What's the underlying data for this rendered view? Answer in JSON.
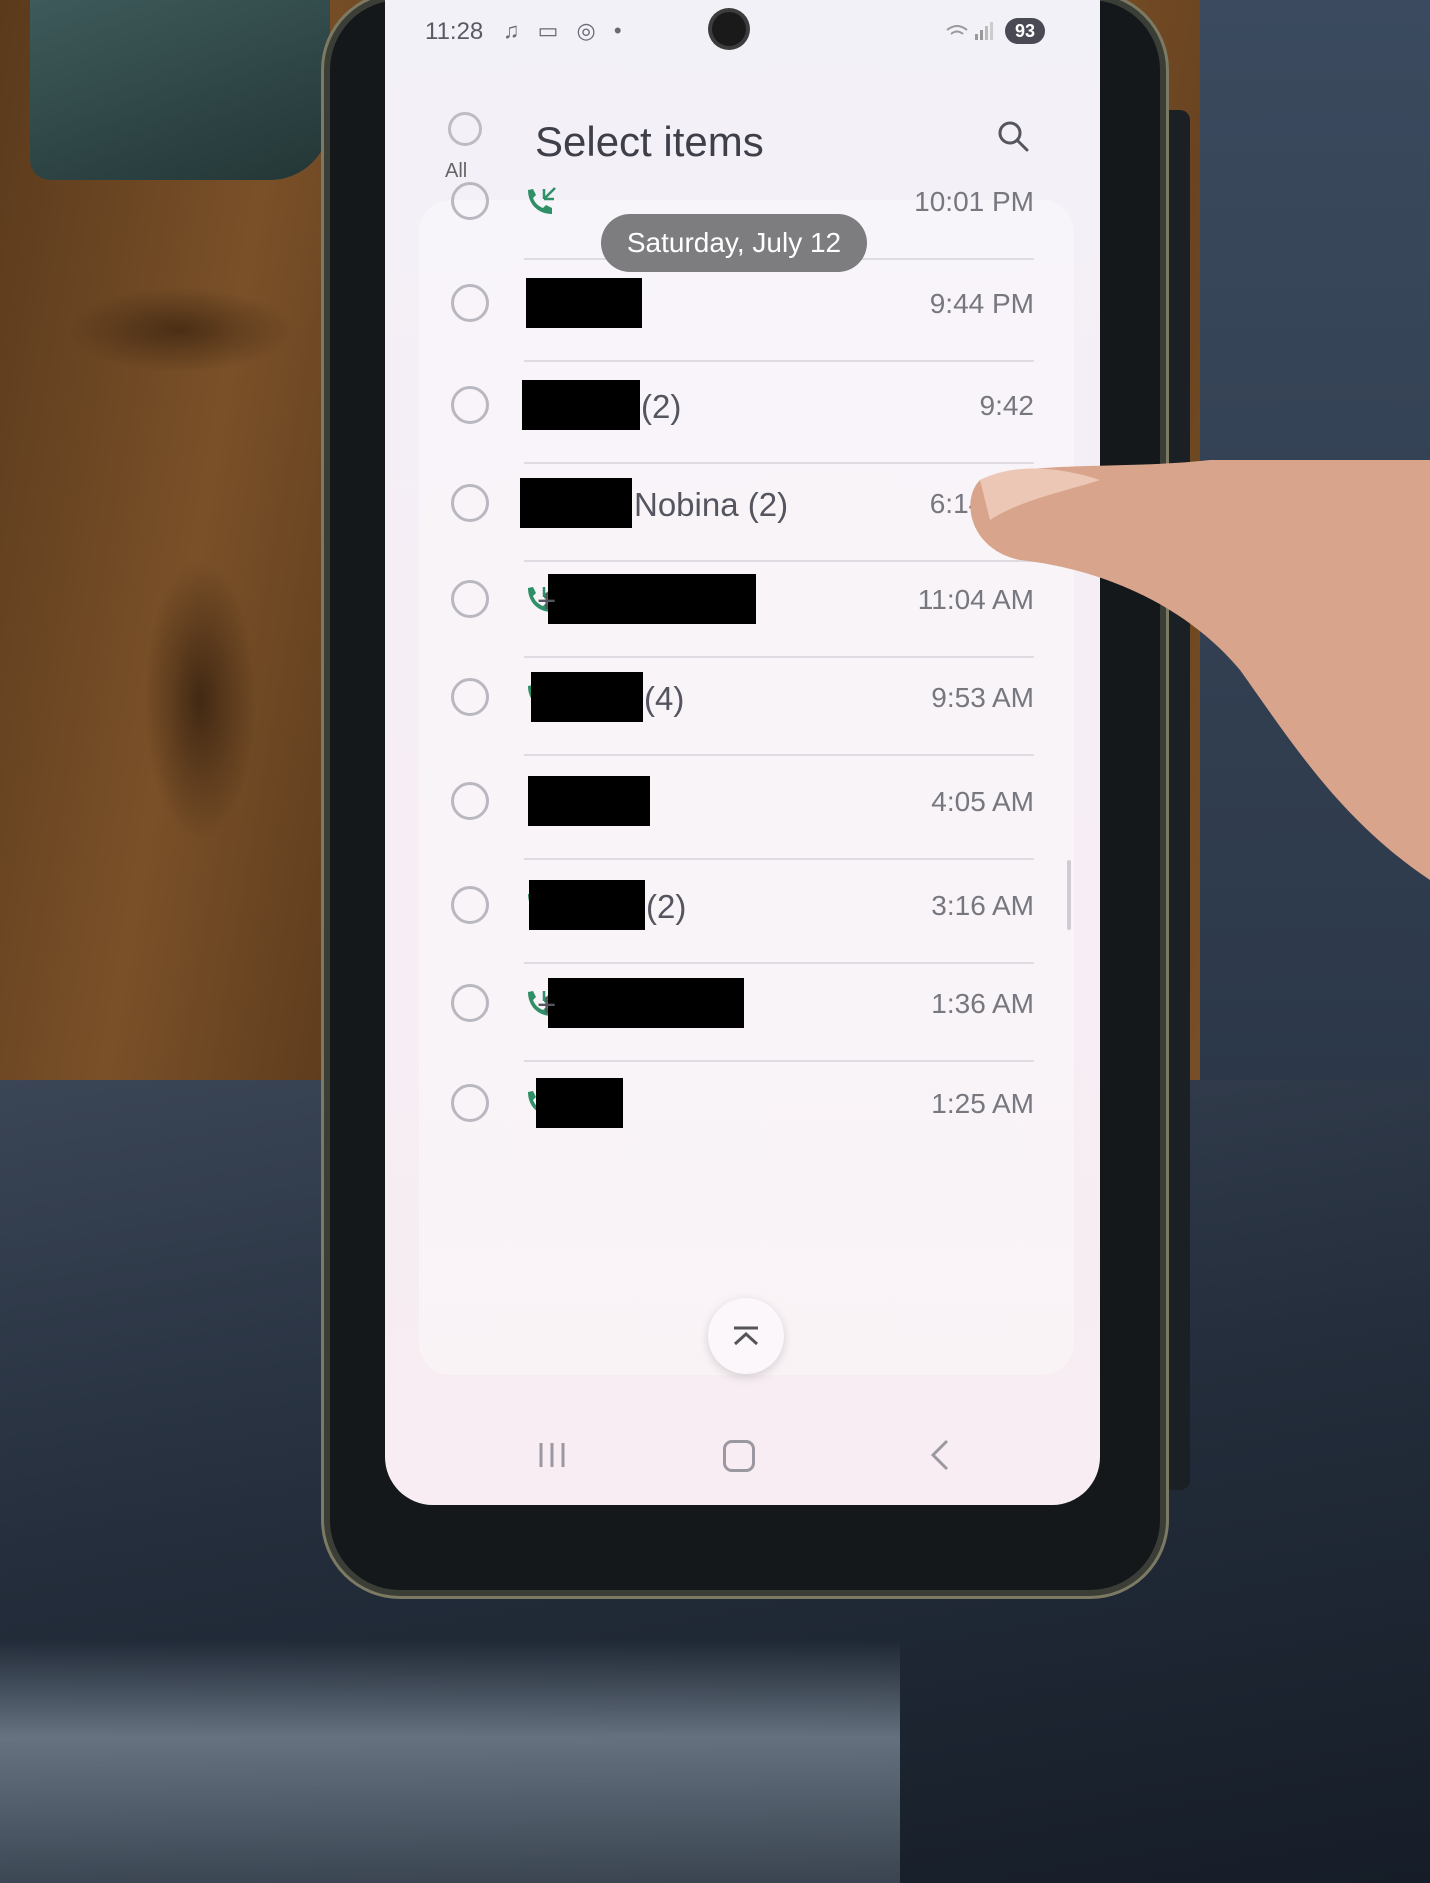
{
  "status_bar": {
    "time": "11:28",
    "notification_icons": "♫ ▭ ◎ •",
    "battery": "93"
  },
  "header": {
    "all_label": "All",
    "title": "Select items"
  },
  "date_pill": "Saturday, July 12",
  "calls": [
    {
      "direction": "incoming",
      "suffix": "",
      "time": "10:01 PM"
    },
    {
      "direction": "outgoing",
      "suffix": "",
      "time": "9:44 PM"
    },
    {
      "direction": "incoming",
      "suffix": "(2)",
      "time": "9:42"
    },
    {
      "direction": "incoming",
      "suffix": "Nobina (2)",
      "time": "6:14 PM"
    },
    {
      "direction": "incoming",
      "suffix": "+",
      "time": "11:04 AM"
    },
    {
      "direction": "incoming",
      "suffix": "(4)",
      "time": "9:53 AM"
    },
    {
      "direction": "incoming",
      "suffix": "",
      "time": "4:05 AM"
    },
    {
      "direction": "incoming",
      "suffix": "(2)",
      "time": "3:16 AM"
    },
    {
      "direction": "incoming",
      "suffix": "+",
      "time": "1:36 AM"
    },
    {
      "direction": "outgoing",
      "suffix": "",
      "time": "1:25 AM"
    }
  ],
  "icons": {
    "search": "search-icon",
    "incoming": "incoming-call-icon",
    "outgoing": "outgoing-call-icon",
    "scroll_top": "scroll-to-top-icon",
    "recents": "recents-icon",
    "home": "home-icon",
    "back": "back-icon"
  },
  "colors": {
    "call_icon": "#2f8f67",
    "title": "#3f3f4a",
    "date_pill": "#7d7d80"
  }
}
